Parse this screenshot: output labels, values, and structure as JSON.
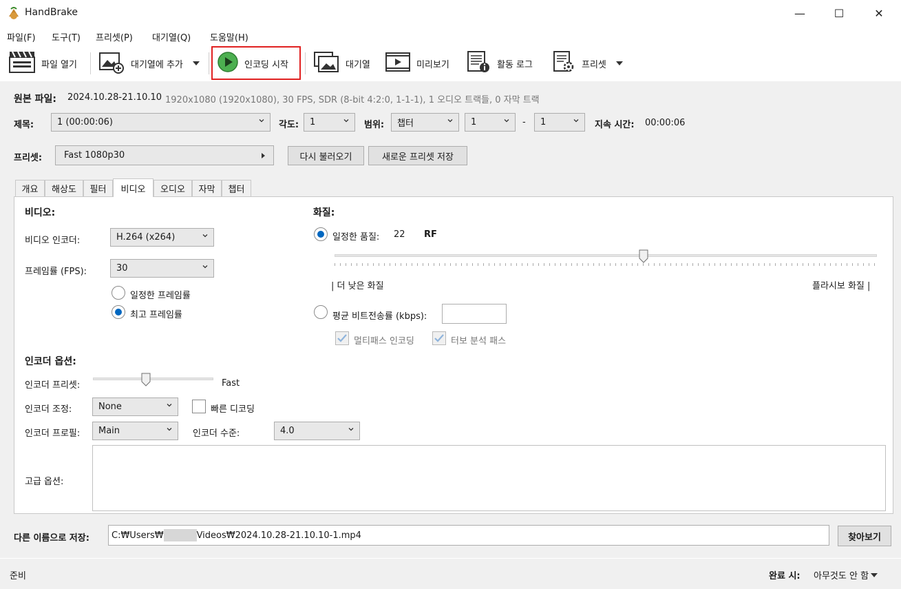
{
  "window": {
    "title": "HandBrake",
    "minimize": "—",
    "maximize": "☐",
    "close": "✕"
  },
  "menu": [
    "파일(F)",
    "도구(T)",
    "프리셋(P)",
    "대기열(Q)",
    "도움말(H)"
  ],
  "toolbar": {
    "open_source": "파일 열기",
    "add_to_queue": "대기열에 추가",
    "start_encode": "인코딩 시작",
    "queue": "대기열",
    "preview": "미리보기",
    "activity_log": "활동 로그",
    "presets": "프리셋"
  },
  "source": {
    "label": "원본 파일:",
    "name": "2024.10.28-21.10.10",
    "info": "1920x1080 (1920x1080), 30 FPS, SDR (8-bit 4:2:0, 1-1-1), 1 오디오 트랙들, 0 자막 트랙"
  },
  "title_row": {
    "title_label": "제목:",
    "title_value": "1  (00:00:06)",
    "angle_label": "각도:",
    "angle_value": "1",
    "range_label": "범위:",
    "range_type": "챕터",
    "range_start": "1",
    "range_dash": "-",
    "range_end": "1",
    "duration_label": "지속 시간:",
    "duration_value": "00:00:06"
  },
  "preset_row": {
    "label": "프리셋:",
    "value": "Fast 1080p30",
    "reload": "다시 불러오기",
    "save_new": "새로운 프리셋 저장"
  },
  "tabs": [
    "개요",
    "해상도",
    "필터",
    "비디오",
    "오디오",
    "자막",
    "챕터"
  ],
  "video": {
    "section": "비디오:",
    "encoder_label": "비디오 인코더:",
    "encoder_value": "H.264 (x264)",
    "fps_label": "프레임률 (FPS):",
    "fps_value": "30",
    "constant_fps": "일정한 프레임률",
    "peak_fps": "최고 프레임률",
    "peak_selected": true
  },
  "quality": {
    "section": "화질:",
    "constant_label": "일정한 품질:",
    "rf_value": "22",
    "rf_unit": "RF",
    "rf_fraction": 0.57,
    "low_label": "| 더 낮은 화질",
    "high_label": "플라시보 화질 |",
    "avg_bitrate_label": "평균 비트전송률 (kbps):",
    "avg_bitrate_value": "",
    "multipass": "멀티패스 인코딩",
    "turbo": "터보 분석 패스"
  },
  "encoder_options": {
    "section": "인코더 옵션:",
    "preset_label": "인코더 프리셋:",
    "preset_value": "Fast",
    "preset_fraction": 0.44,
    "tune_label": "인코더 조정:",
    "tune_value": "None",
    "fast_decode": "빠른 디코딩",
    "profile_label": "인코더 프로필:",
    "profile_value": "Main",
    "level_label": "인코더 수준:",
    "level_value": "4.0",
    "advanced_label": "고급 옵션:",
    "advanced_value": ""
  },
  "save_as": {
    "label": "다른 이름으로 저장:",
    "path_prefix": "C:₩Users₩",
    "path_suffix": "Videos₩2024.10.28-21.10.10-1.mp4",
    "browse": "찾아보기"
  },
  "status": {
    "text": "준비",
    "when_done_label": "완료 시:",
    "when_done_value": "아무것도 안 함"
  },
  "colors": {
    "accent": "#0067c0",
    "highlight": "#e02020",
    "play_green": "#4caf50"
  }
}
